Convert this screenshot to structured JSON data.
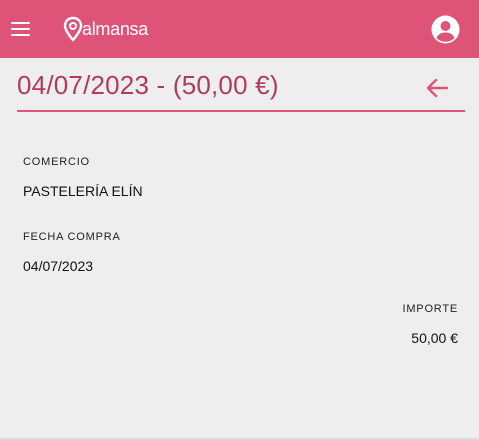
{
  "app": {
    "logo_text": "almansa",
    "brand_color": "#de5479",
    "title_color": "#b03a62",
    "icons": [
      "menu-icon",
      "location-pin-icon",
      "account-circle-icon",
      "arrow-back-icon"
    ]
  },
  "header": {
    "title": "04/07/2023 - (50,00 €)"
  },
  "details": {
    "merchant_label": "COMERCIO",
    "merchant_value": "PASTELERÍA ELÍN",
    "date_label": "FECHA COMPRA",
    "date_value": "04/07/2023",
    "amount_label": "IMPORTE",
    "amount_value": "50,00 €"
  }
}
